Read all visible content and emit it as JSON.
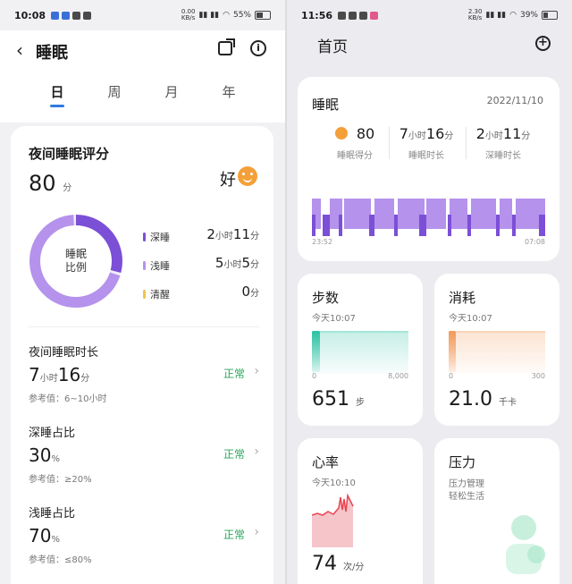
{
  "left": {
    "status": {
      "time": "10:08",
      "net": "0.00\nKB/s",
      "battery": "55%",
      "battery_level": 0.55
    },
    "title": "睡眠",
    "tabs": [
      "日",
      "周",
      "月",
      "年"
    ],
    "score_card": {
      "title": "夜间睡眠评分",
      "score": "80",
      "score_unit": "分",
      "rating": "好",
      "donut_label": "睡眠\n比例",
      "legend": [
        {
          "label": "深睡",
          "h": "2",
          "m": "11",
          "color": "#7b4fd6",
          "minutes": 131
        },
        {
          "label": "浅睡",
          "h": "5",
          "m": "5",
          "color": "#b592ec",
          "minutes": 305
        },
        {
          "label": "清醒",
          "m": "0",
          "color": "#f2c446",
          "minutes": 0
        }
      ],
      "unit_h": "小时",
      "unit_m": "分"
    },
    "rows": [
      {
        "label": "夜间睡眠时长",
        "v1": "7",
        "u1": "小时",
        "v2": "16",
        "u2": "分",
        "status": "正常",
        "ref": "参考值：6~10小时"
      },
      {
        "label": "深睡占比",
        "v1": "30",
        "u1": "%",
        "status": "正常",
        "ref": "参考值：≥20%"
      },
      {
        "label": "浅睡占比",
        "v1": "70",
        "u1": "%",
        "status": "正常",
        "ref": "参考值：≤80%"
      }
    ]
  },
  "right": {
    "status": {
      "time": "11:56",
      "net": "2.30\nKB/s",
      "battery": "39%",
      "battery_level": 0.39
    },
    "title": "首页",
    "sleep": {
      "title": "睡眠",
      "date": "2022/11/10",
      "score": "80",
      "score_label": "睡眠得分",
      "dur_h": "7",
      "dur_m": "16",
      "dur_label": "睡眠时长",
      "deep_h": "2",
      "deep_m": "11",
      "deep_label": "深睡时长",
      "unit_h": "小时",
      "unit_m": "分",
      "start": "23:52",
      "end": "07:08",
      "colors": {
        "light": "#b592ec",
        "deep": "#7b4fd6"
      }
    },
    "steps": {
      "title": "步数",
      "sub": "今天10:07",
      "axis_min": "0",
      "axis_max": "8,000",
      "value": "651",
      "unit": "步",
      "goal": 8000,
      "color": "#2ec2a4"
    },
    "calories": {
      "title": "消耗",
      "sub": "今天10:07",
      "axis_min": "0",
      "axis_max": "300",
      "value": "21.0",
      "unit": "千卡",
      "goal": 300,
      "color": "#f29a5a"
    },
    "heart": {
      "title": "心率",
      "sub": "今天10:10",
      "value": "74",
      "unit": "次/分",
      "color": "#e9434f"
    },
    "stress": {
      "title": "压力",
      "sub1": "压力管理",
      "sub2": "轻松生活",
      "color": "#3dc48d"
    }
  }
}
